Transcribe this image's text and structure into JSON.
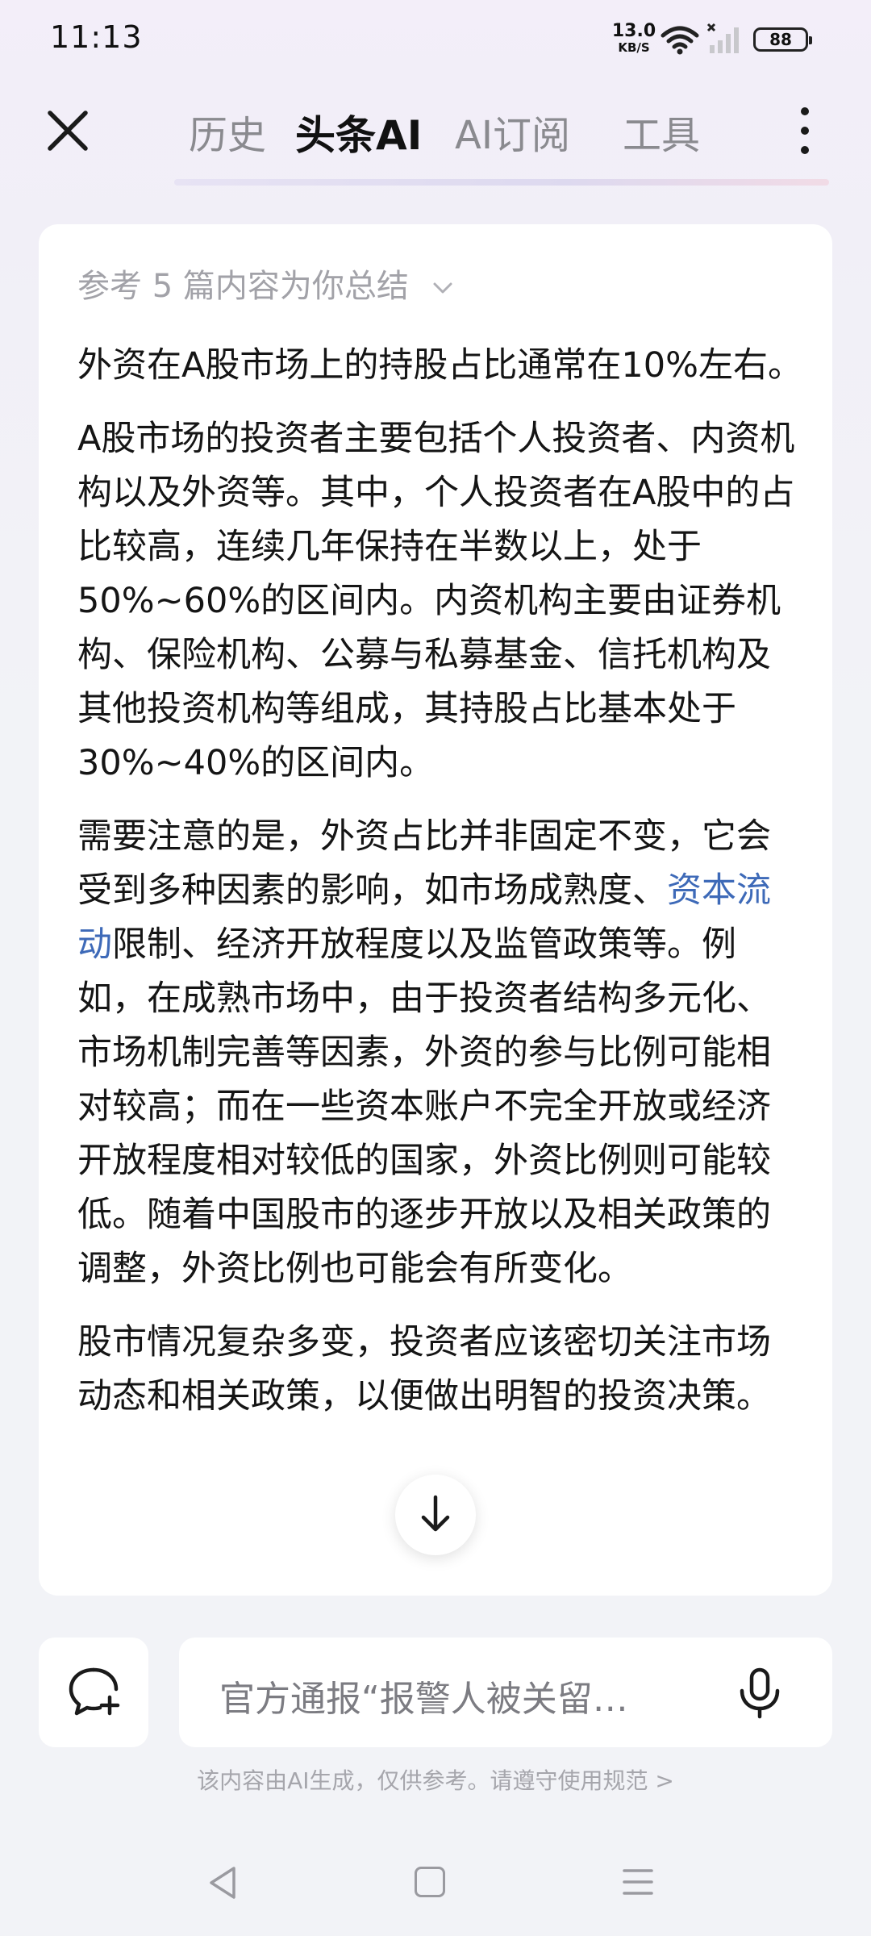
{
  "status_bar": {
    "time": "11:13",
    "net_speed_value": "13.0",
    "net_speed_unit": "KB/S",
    "battery": "88"
  },
  "header": {
    "tabs": [
      {
        "label": "历史"
      },
      {
        "label": "头条AI",
        "active": true
      },
      {
        "label": "AI订阅"
      },
      {
        "label": "工具"
      }
    ]
  },
  "content": {
    "ref_summary": "参考 5 篇内容为你总结",
    "p1": "外资在A股市场上的持股占比通常在10%左右。",
    "p2": "A股市场的投资者主要包括个人投资者、内资机构以及外资等。其中，个人投资者在A股中的占比较高，连续几年保持在半数以上，处于50%~60%的区间内。内资机构主要由证券机构、保险机构、公募与私募基金、信托机构及其他投资机构等组成，其持股占比基本处于30%~40%的区间内。",
    "p3_before": "需要注意的是，外资占比并非固定不变，它会受到多种因素的影响，如市场成熟度、",
    "p3_link": "资本流动",
    "p3_after": "限制、经济开放程度以及监管政策等。例如，在成熟市场中，由于投资者结构多元化、市场机制完善等因素，外资的参与比例可能相对较高；而在一些资本账户不完全开放或经济开放程度相对较低的国家，外资比例则可能较低。随着中国股市的逐步开放以及相关政策的调整，外资比例也可能会有所变化。",
    "p4": "股市情况复杂多变，投资者应该密切关注市场动态和相关政策，以便做出明智的投资决策。"
  },
  "input": {
    "placeholder": "官方通报“报警人被关留…"
  },
  "disclaimer": "该内容由AI生成，仅供参考。请遵守使用规范 >",
  "icons": {
    "close": "close-icon",
    "more": "more-vertical-icon",
    "new_chat": "new-chat-icon",
    "mic": "mic-icon",
    "scroll_down": "arrow-down-icon"
  },
  "colors": {
    "link": "#3e6ab8",
    "active_tab": "#111111",
    "inactive_tab": "#8a8a8f"
  }
}
